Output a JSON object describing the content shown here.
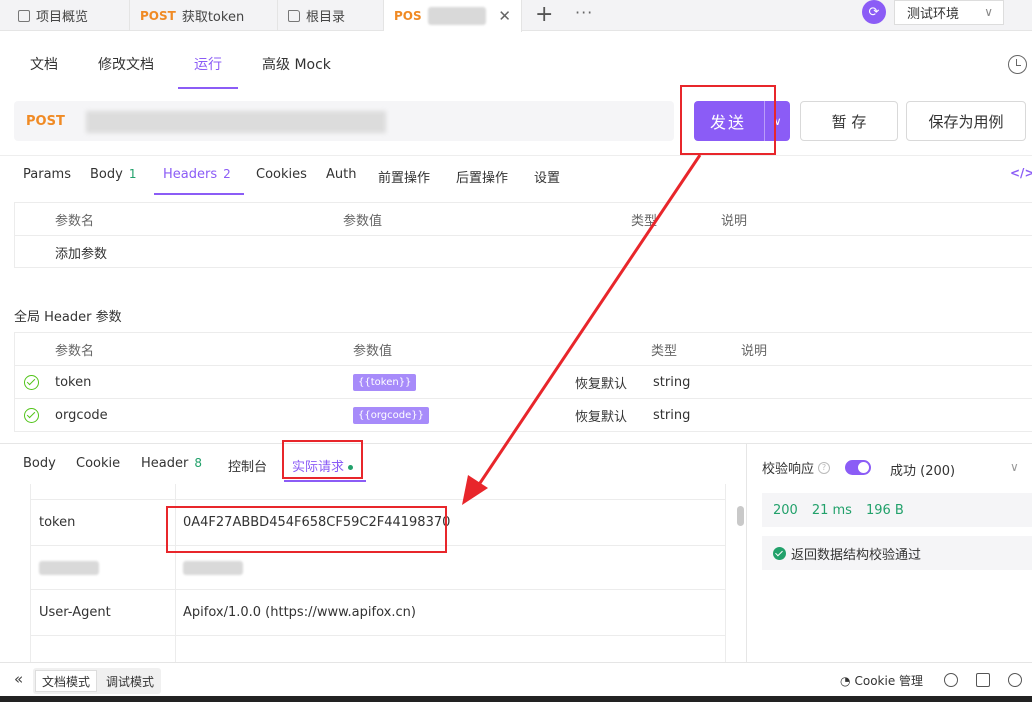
{
  "tabs": [
    {
      "label": "项目概览",
      "icon": "overview-icon"
    },
    {
      "method": "POST",
      "label": "获取token"
    },
    {
      "label": "根目录",
      "icon": "folder-icon"
    },
    {
      "method": "POS",
      "label": ""
    }
  ],
  "environment": {
    "label": "测试环境"
  },
  "topnav": {
    "items": [
      "文档",
      "修改文档",
      "运行",
      "高级 Mock"
    ],
    "active": "运行"
  },
  "request": {
    "method": "POST",
    "send": "发送",
    "save": "暂 存",
    "save_case": "保存为用例"
  },
  "reqtabs": {
    "params": "Params",
    "body": "Body",
    "body_count": "1",
    "headers": "Headers",
    "headers_count": "2",
    "cookies": "Cookies",
    "auth": "Auth",
    "pre": "前置操作",
    "post": "后置操作",
    "settings": "设置"
  },
  "params_table": {
    "col_name": "参数名",
    "col_value": "参数值",
    "col_type": "类型",
    "col_desc": "说明",
    "add_placeholder": "添加参数"
  },
  "global_headers": {
    "title": "全局 Header 参数",
    "col_name": "参数名",
    "col_value": "参数值",
    "col_type": "类型",
    "col_desc": "说明",
    "rows": [
      {
        "name": "token",
        "value": "{{token}}",
        "reset": "恢复默认",
        "type": "string"
      },
      {
        "name": "orgcode",
        "value": "{{orgcode}}",
        "reset": "恢复默认",
        "type": "string"
      }
    ]
  },
  "response_tabs": {
    "body": "Body",
    "cookie": "Cookie",
    "header": "Header",
    "header_count": "8",
    "console": "控制台",
    "actual": "实际请求"
  },
  "actual_request": {
    "rows": [
      {
        "key": "token",
        "value": "0A4F27ABBD454F658CF59C2F44198370"
      },
      {
        "key": "User-Agent",
        "value": "Apifox/1.0.0 (https://www.apifox.cn)"
      }
    ]
  },
  "validation": {
    "label": "校验响应",
    "result": "成功 (200)",
    "status": "200",
    "time": "21 ms",
    "size": "196 B",
    "pass_text": "返回数据结构校验通过"
  },
  "bottombar": {
    "doc_mode": "文档模式",
    "debug_mode": "调试模式",
    "cookie_mgr": "Cookie 管理"
  },
  "colors": {
    "accent": "#8b5cf6",
    "method": "#f08a24",
    "success": "#22a16b",
    "highlight": "#e8262b"
  }
}
